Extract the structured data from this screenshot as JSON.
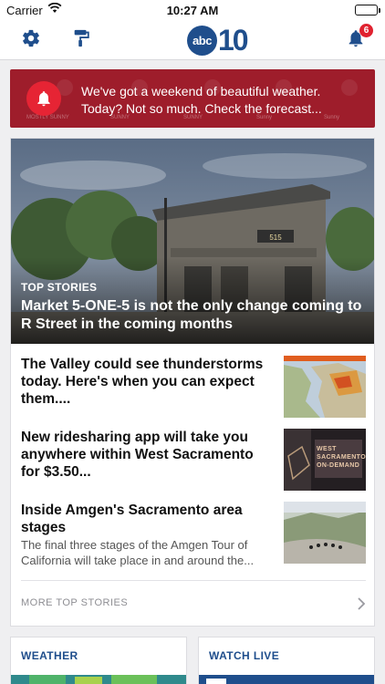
{
  "status": {
    "carrier": "Carrier",
    "time": "10:27 AM"
  },
  "nav": {
    "logo_abc": "abc",
    "logo_number": "10",
    "notification_count": "6"
  },
  "alert": {
    "message": "We've got a weekend of beautiful weather. Today? Not so much. Check the forecast...",
    "bg_labels": [
      "MOSTLY SUNNY",
      "SUNNY",
      "SUNNY",
      "Sunny",
      "Sunny"
    ]
  },
  "hero": {
    "kicker": "TOP STORIES",
    "headline": "Market 5-ONE-5 is not the only change coming to R Street in the coming months",
    "sign_text": "515"
  },
  "stories": [
    {
      "title": "The Valley could see thunderstorms today. Here's when you can expect them....",
      "description": ""
    },
    {
      "title": "New ridesharing app will take you anywhere within West Sacramento for $3.50...",
      "description": "",
      "thumb_text": "WEST SACRAMENTO ON-DEMAND"
    },
    {
      "title": "Inside Amgen's Sacramento area stages",
      "description": "The final three stages of the Amgen Tour of California will take place in and around the..."
    }
  ],
  "more_label": "MORE TOP STORIES",
  "tiles": {
    "weather": "WEATHER",
    "live": "WATCH LIVE"
  },
  "colors": {
    "brand_blue": "#1f4e8c",
    "alert_red": "#9e1d2b",
    "badge_red": "#e0212f"
  }
}
